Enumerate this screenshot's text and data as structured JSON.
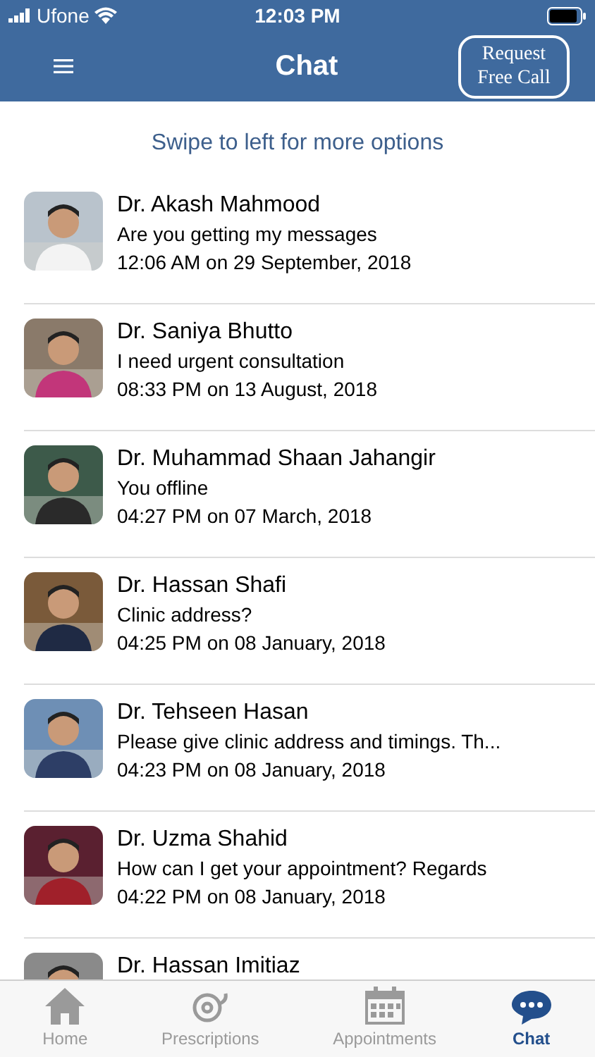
{
  "status_bar": {
    "carrier": "Ufone",
    "time": "12:03 PM"
  },
  "header": {
    "title": "Chat",
    "action": "Request\nFree Call"
  },
  "hint": "Swipe to left for more options",
  "chats": [
    {
      "name": "Dr. Akash Mahmood",
      "message": "Are you getting my messages",
      "time": "12:06 AM on 29 September, 2018"
    },
    {
      "name": "Dr. Saniya Bhutto",
      "message": "I need urgent consultation",
      "time": "08:33 PM on 13 August, 2018"
    },
    {
      "name": "Dr. Muhammad Shaan Jahangir",
      "message": "You offline",
      "time": "04:27 PM on 07 March, 2018"
    },
    {
      "name": "Dr. Hassan Shafi",
      "message": "Clinic address?",
      "time": "04:25 PM on 08 January, 2018"
    },
    {
      "name": "Dr. Tehseen Hasan",
      "message": "Please give clinic address and timings. Th...",
      "time": "04:23 PM on 08 January, 2018"
    },
    {
      "name": "Dr. Uzma Shahid",
      "message": "How can I get your appointment? Regards",
      "time": "04:22 PM on 08 January, 2018"
    },
    {
      "name": "Dr. Hassan Imitiaz"
    }
  ],
  "tab_bar": [
    {
      "kind": "home",
      "label": "Home",
      "selected": false
    },
    {
      "kind": "prescriptions",
      "label": "Prescriptions",
      "selected": false
    },
    {
      "kind": "appointments",
      "label": "Appointments",
      "selected": false
    },
    {
      "kind": "chat",
      "label": "Chat",
      "selected": true
    }
  ]
}
